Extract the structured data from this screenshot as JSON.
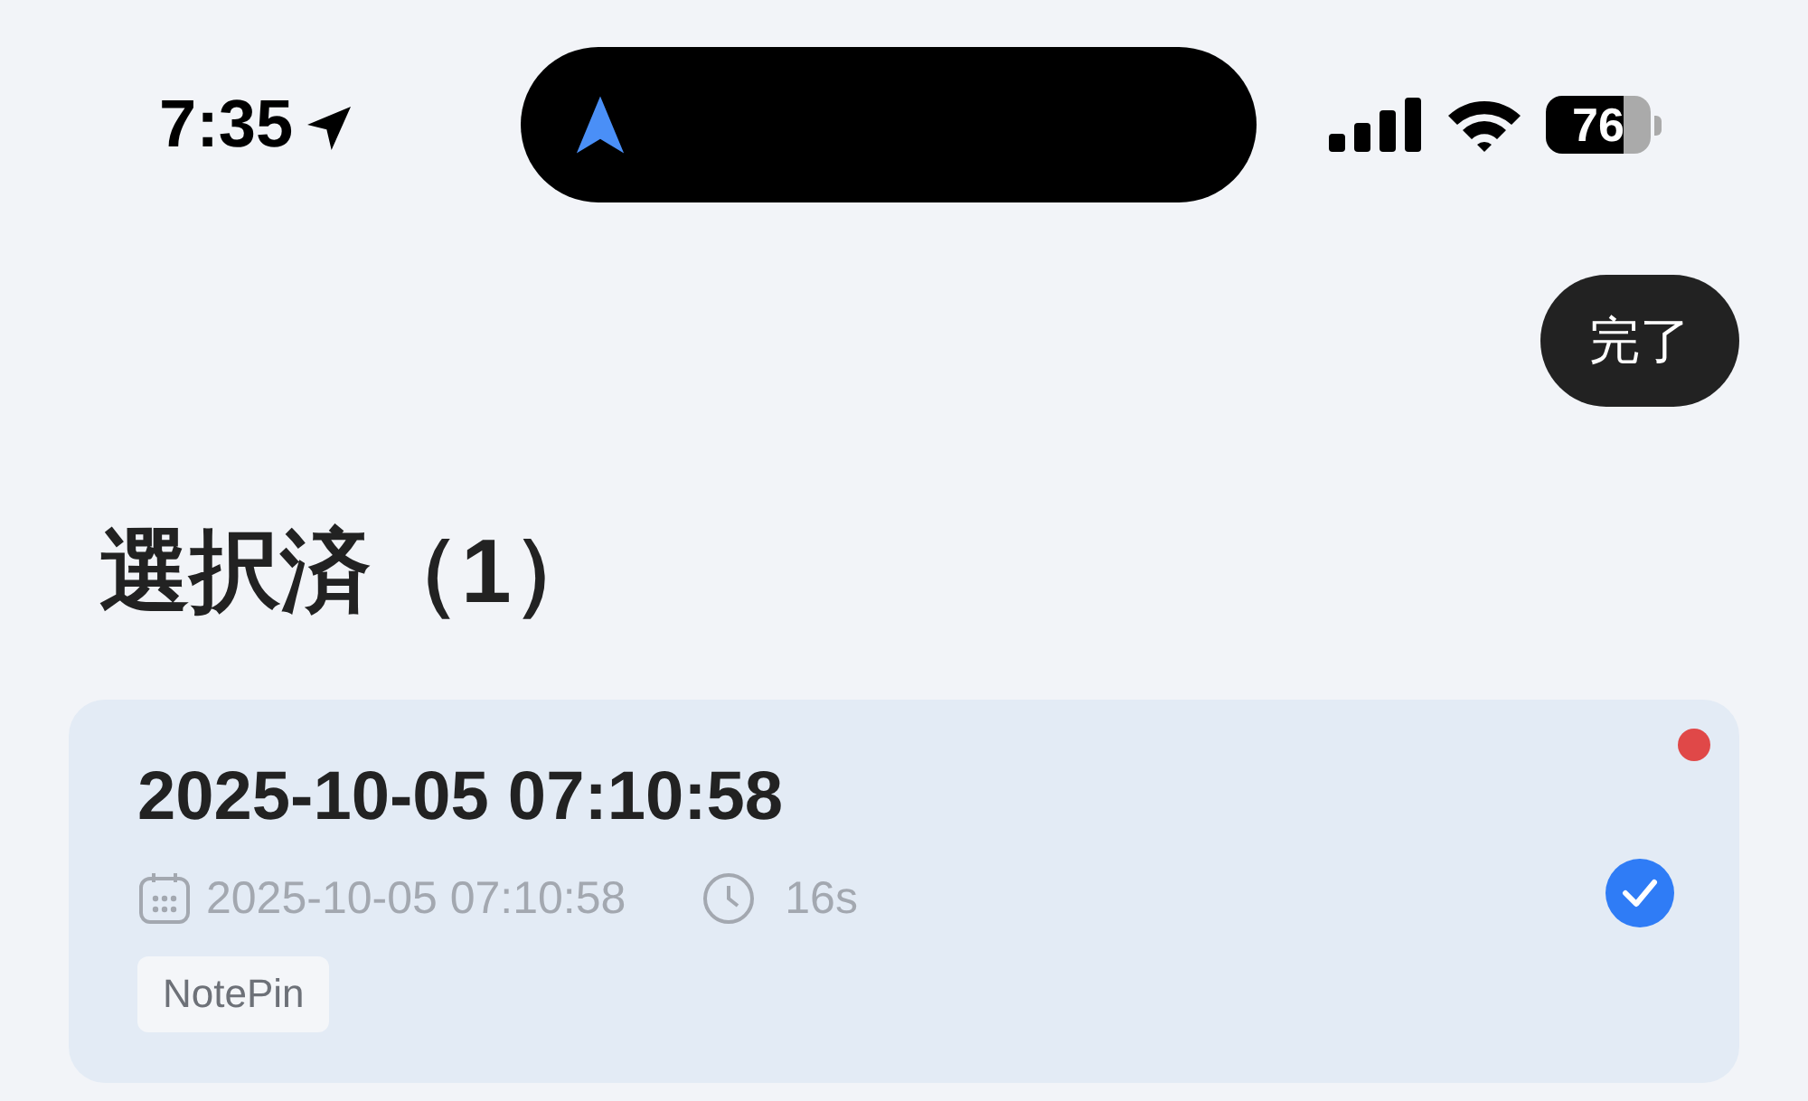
{
  "status_bar": {
    "time": "7:35",
    "battery": "76"
  },
  "done_button": "完了",
  "heading": "選択済（1）",
  "recordings": [
    {
      "title": "2025-10-05 07:10:58",
      "date": "2025-10-05 07:10:58",
      "duration": "16s",
      "tag": "NotePin",
      "selected": true,
      "unread": true
    }
  ]
}
